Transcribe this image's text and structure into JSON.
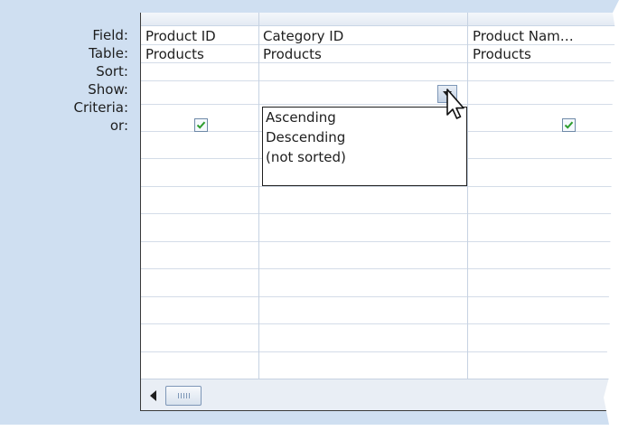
{
  "row_labels": [
    "Field:",
    "Table:",
    "Sort:",
    "Show:",
    "Criteria:",
    "or:"
  ],
  "columns": [
    {
      "field": "Product ID",
      "table": "Products",
      "show": true
    },
    {
      "field": "Category ID",
      "table": "Products",
      "show": false
    },
    {
      "field": "Product Nam…",
      "table": "Products",
      "show": true
    }
  ],
  "sort_dropdown": {
    "options": [
      "Ascending",
      "Descending",
      "(not sorted)"
    ]
  },
  "icons": {
    "dropdown": "chevron-down-icon",
    "checkbox": "checkmark-icon",
    "scroll_left": "arrow-left-icon",
    "scroll_thumb": "grip-icon",
    "pointer": "mouse-pointer-icon"
  },
  "colors": {
    "background": "#cfdff1",
    "grid_lines": "#d4dce8",
    "check": "#2e9e2e"
  }
}
